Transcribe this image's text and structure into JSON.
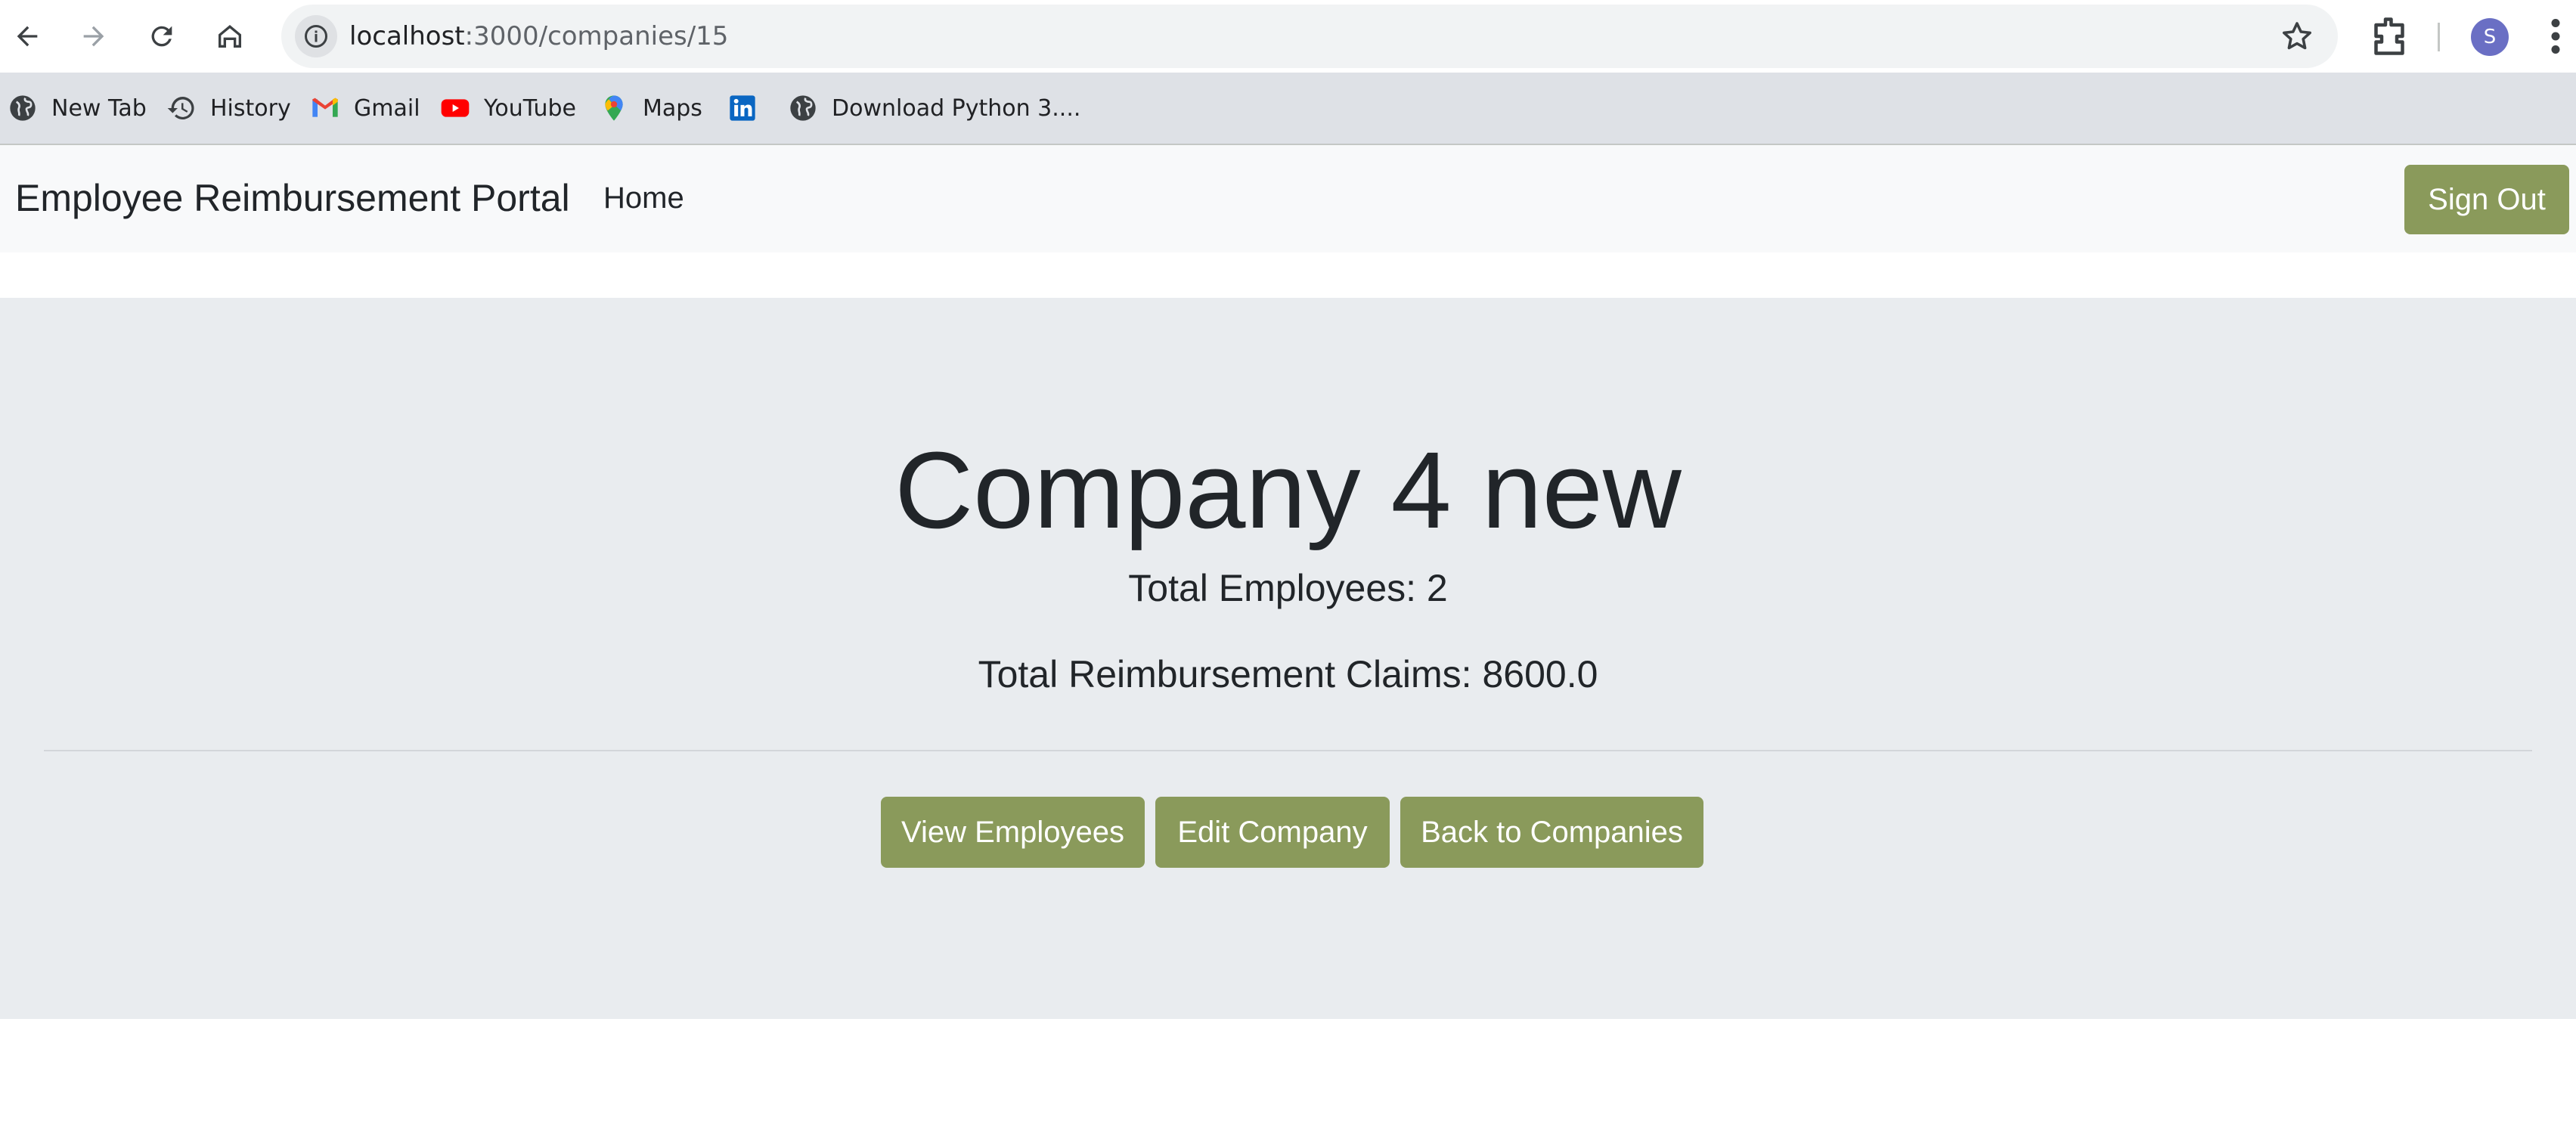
{
  "browser": {
    "url_host": "localhost",
    "url_path": ":3000/companies/15",
    "profile_initial": "S",
    "bookmarks": [
      {
        "label": "New Tab",
        "icon": "globe-icon"
      },
      {
        "label": "History",
        "icon": "history-icon"
      },
      {
        "label": "Gmail",
        "icon": "gmail-icon"
      },
      {
        "label": "YouTube",
        "icon": "youtube-icon"
      },
      {
        "label": "Maps",
        "icon": "maps-icon"
      },
      {
        "label": "",
        "icon": "linkedin-icon"
      },
      {
        "label": "Download Python 3....",
        "icon": "globe-icon"
      }
    ]
  },
  "navbar": {
    "brand": "Employee Reimbursement Portal",
    "home": "Home",
    "sign_out": "Sign Out"
  },
  "company": {
    "title": "Company 4 new",
    "total_employees": "Total Employees: 2",
    "total_claims": "Total Reimbursement Claims: 8600.0"
  },
  "actions": {
    "view_employees": "View Employees",
    "edit_company": "Edit Company",
    "back_to_companies": "Back to Companies"
  },
  "colors": {
    "accent": "#8a9a5b",
    "navbar_bg": "#f8f9fa",
    "jumbotron_bg": "#e9ecef"
  }
}
